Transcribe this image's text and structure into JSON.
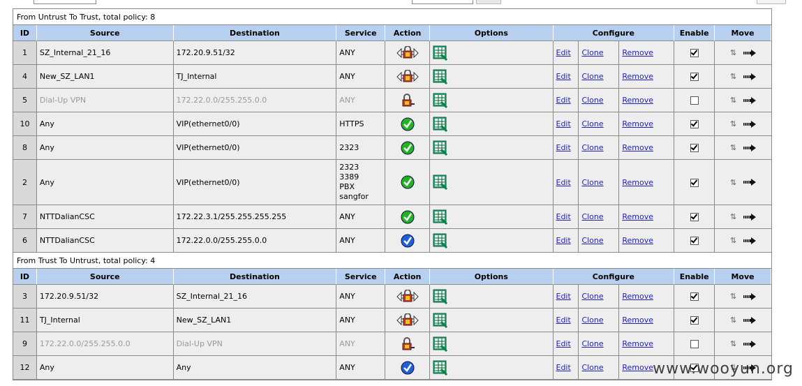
{
  "sections": [
    {
      "title": "From Untrust To Trust, total policy: 8",
      "headers": [
        "ID",
        "Source",
        "Destination",
        "Service",
        "Action",
        "Options",
        "Configure",
        "Enable",
        "Move"
      ],
      "rows": [
        {
          "id": "1",
          "source": "SZ_Internal_21_16",
          "destination": "172.20.9.51/32",
          "service": [
            "ANY"
          ],
          "action": "tunnel-icon",
          "enabled": true,
          "disabled": false
        },
        {
          "id": "4",
          "source": "New_SZ_LAN1",
          "destination": "TJ_Internal",
          "service": [
            "ANY"
          ],
          "action": "tunnel-icon",
          "enabled": true,
          "disabled": false
        },
        {
          "id": "5",
          "source": "Dial-Up VPN",
          "destination": "172.22.0.0/255.255.0.0",
          "service": [
            "ANY"
          ],
          "action": "lock-icon",
          "enabled": false,
          "disabled": true
        },
        {
          "id": "10",
          "source": "Any",
          "destination": "VIP(ethernet0/0)",
          "service": [
            "HTTPS"
          ],
          "action": "permit-icon",
          "enabled": true,
          "disabled": false
        },
        {
          "id": "8",
          "source": "Any",
          "destination": "VIP(ethernet0/0)",
          "service": [
            "2323"
          ],
          "action": "permit-icon",
          "enabled": true,
          "disabled": false
        },
        {
          "id": "2",
          "source": "Any",
          "destination": "VIP(ethernet0/0)",
          "service": [
            "2323",
            "3389",
            "PBX",
            "sangfor"
          ],
          "action": "permit-icon",
          "enabled": true,
          "disabled": false
        },
        {
          "id": "7",
          "source": "NTTDalianCSC",
          "destination": "172.22.3.1/255.255.255.255",
          "service": [
            "ANY"
          ],
          "action": "permit-icon",
          "enabled": true,
          "disabled": false
        },
        {
          "id": "6",
          "source": "NTTDalianCSC",
          "destination": "172.22.0.0/255.255.0.0",
          "service": [
            "ANY"
          ],
          "action": "permit-blue-icon",
          "enabled": true,
          "disabled": false
        }
      ]
    },
    {
      "title": "From Trust To Untrust, total policy: 4",
      "headers": [
        "ID",
        "Source",
        "Destination",
        "Service",
        "Action",
        "Options",
        "Configure",
        "Enable",
        "Move"
      ],
      "rows": [
        {
          "id": "3",
          "source": "172.20.9.51/32",
          "destination": "SZ_Internal_21_16",
          "service": [
            "ANY"
          ],
          "action": "tunnel-icon",
          "enabled": true,
          "disabled": false
        },
        {
          "id": "11",
          "source": "TJ_Internal",
          "destination": "New_SZ_LAN1",
          "service": [
            "ANY"
          ],
          "action": "tunnel-icon",
          "enabled": true,
          "disabled": false
        },
        {
          "id": "9",
          "source": "172.22.0.0/255.255.0.0",
          "destination": "Dial-Up VPN",
          "service": [
            "ANY"
          ],
          "action": "lock-icon",
          "enabled": false,
          "disabled": true
        },
        {
          "id": "12",
          "source": "Any",
          "destination": "Any",
          "service": [
            "ANY"
          ],
          "action": "permit-blue-icon",
          "enabled": true,
          "disabled": false
        }
      ]
    }
  ],
  "links": {
    "edit": "Edit",
    "clone": "Clone",
    "remove": "Remove"
  },
  "watermark": "www.wooyun.org",
  "colors": {
    "header_bg": "#b7d0ef",
    "row_bg": "#eeeeee",
    "id_bg": "#d9d9d9",
    "link": "#1f1fb8",
    "permit_green": "#22b322",
    "permit_blue": "#1f5fd8"
  }
}
